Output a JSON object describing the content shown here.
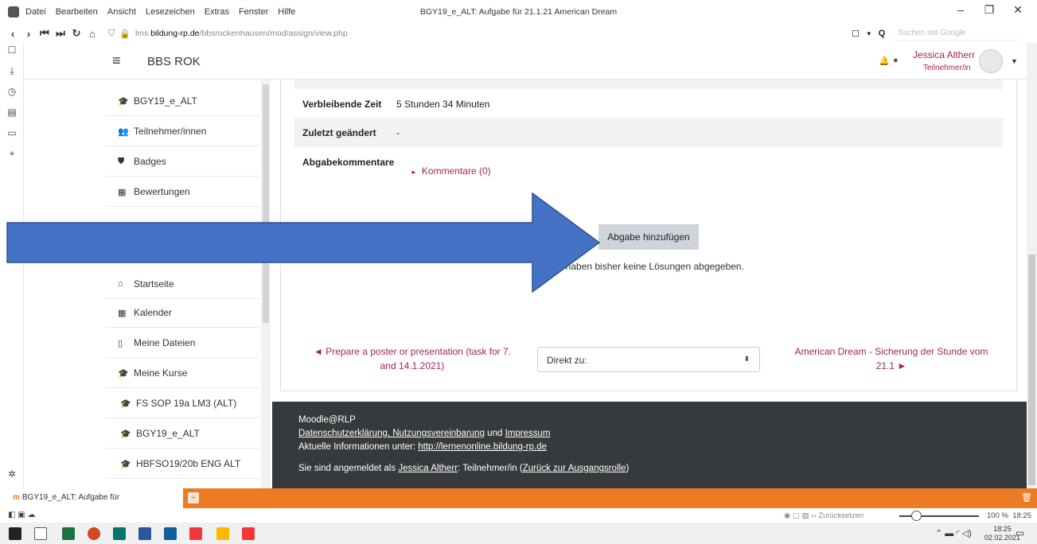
{
  "browser": {
    "menu": [
      "Datei",
      "Bearbeiten",
      "Ansicht",
      "Lesezeichen",
      "Extras",
      "Fenster",
      "Hilfe"
    ],
    "window_title": "BGY19_e_ALT: Aufgabe für 21.1.21 American Dream",
    "url_domain": "lms.bildung-rp.de",
    "url_prefix": "lms.",
    "url_host": "bildung-rp.de",
    "url_path": "/bbsrockenhausen/mod/assign/view.php",
    "search_placeholder": "Suchen mit Google",
    "tab_title": "BGY19_e_ALT: Aufgabe für",
    "status_reset": "Zurücksetzen",
    "zoom": "100 %",
    "status_time": "18:25",
    "clock_time": "18:25",
    "clock_date": "02.02.2021"
  },
  "header": {
    "site_name": "BBS ROK",
    "user_name": "Jessica Altherr",
    "user_role": "Teilnehmer/in"
  },
  "sidebar": {
    "items": [
      {
        "label": "BGY19_e_ALT",
        "icon": "graduation-cap-icon"
      },
      {
        "label": "Teilnehmer/innen",
        "icon": "users-icon"
      },
      {
        "label": "Badges",
        "icon": "shield-icon"
      },
      {
        "label": "Bewertungen",
        "icon": "table-icon"
      },
      {
        "label": "Startseite",
        "icon": "home-icon"
      },
      {
        "label": "Kalender",
        "icon": "calendar-icon"
      },
      {
        "label": "Meine Dateien",
        "icon": "file-icon"
      },
      {
        "label": "Meine Kurse",
        "icon": "graduation-cap-icon"
      },
      {
        "label": "FS SOP 19a LM3 (ALT)",
        "icon": "graduation-cap-icon"
      },
      {
        "label": "BGY19_e_ALT",
        "icon": "graduation-cap-icon"
      },
      {
        "label": "HBFSO19/20b ENG ALT",
        "icon": "graduation-cap-icon"
      }
    ]
  },
  "status_table": {
    "rows": [
      {
        "label": "Verbleibende Zeit",
        "value": "5 Stunden 34 Minuten"
      },
      {
        "label": "Zuletzt geändert",
        "value": "-"
      },
      {
        "label": "Abgabekommentare",
        "value": ""
      }
    ],
    "comments_link": "Kommentare (0)"
  },
  "submission": {
    "button": "Abgabe hinzufügen",
    "info": "Sie haben bisher keine Lösungen abgegeben."
  },
  "navigation": {
    "prev_line1": "◄ Prepare a poster or presentation (task for 7.",
    "prev_line2": "and 14.1.2021)",
    "jump_label": "Direkt zu:",
    "next_line1": "American Dream - Sicherung der Stunde vom",
    "next_line2": "21.1 ►"
  },
  "footer": {
    "brand": "Moodle@RLP",
    "privacy": "Datenschutzerklärung, Nutzungsvereinbarung",
    "and": " und ",
    "imprint": "Impressum",
    "info_prefix": "Aktuelle Informationen unter: ",
    "info_link": "http://lernenonline.bildung-rp.de",
    "login_prefix": "Sie sind angemeldet als ",
    "login_user": "Jessica Altherr",
    "login_role": ": Teilnehmer/in (",
    "login_return": "Zurück zur Ausgangsrolle",
    "login_close": ")"
  },
  "colors": {
    "accent": "#a3245c",
    "arrow": "#4472c4",
    "tabbar": "#ec7c24",
    "footer": "#373a3c"
  }
}
